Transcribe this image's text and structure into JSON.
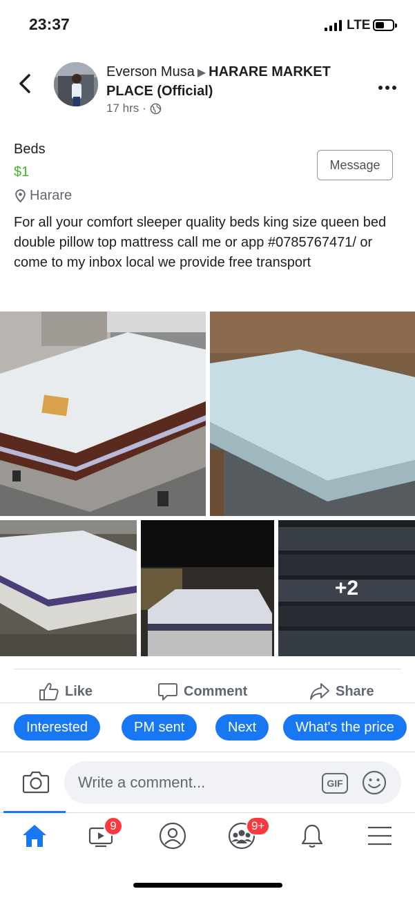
{
  "status_bar": {
    "time": "23:37",
    "network": "LTE"
  },
  "header": {
    "author": "Everson Musa",
    "group": "HARARE MARKET PLACE (Official)",
    "timestamp": "17 hrs",
    "separator": "·"
  },
  "listing": {
    "title": "Beds",
    "price": "$1",
    "location": "Harare",
    "message_button": "Message",
    "description": "For all your comfort sleeper quality beds king size queen bed double pillow top mattress call me or app #0785767471/ or come to my inbox local we provide free transport"
  },
  "photos": {
    "more_count": "+2"
  },
  "actions": {
    "like": "Like",
    "comment": "Comment",
    "share": "Share"
  },
  "quick_replies": [
    "Interested",
    "PM sent",
    "Next",
    "What's the price"
  ],
  "comment": {
    "placeholder": "Write a comment...",
    "gif": "GIF"
  },
  "tabbar": {
    "watch_badge": "9",
    "groups_badge": "9+",
    "accent_color": "#1877f2",
    "icons": [
      "home-icon",
      "watch-icon",
      "profile-icon",
      "groups-icon",
      "bell-icon",
      "menu-icon"
    ]
  }
}
